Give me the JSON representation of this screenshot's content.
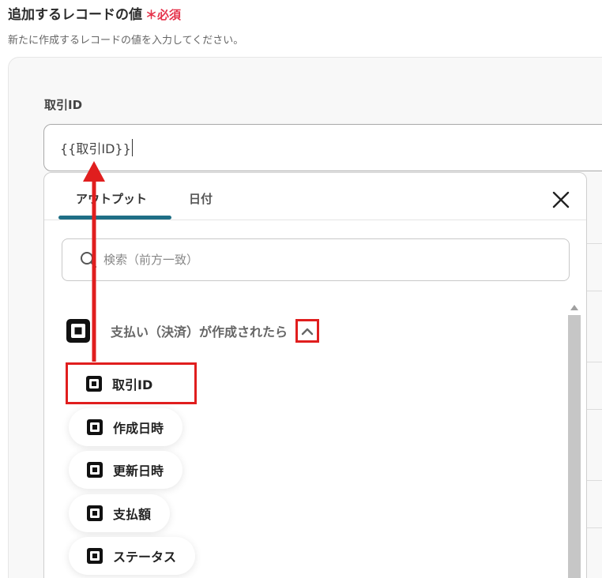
{
  "section": {
    "title": "追加するレコードの値",
    "required_mark": "＊必須",
    "description": "新たに作成するレコードの値を入力してください。"
  },
  "field": {
    "label": "取引ID",
    "value": "{{取引ID}}"
  },
  "dropdown": {
    "tabs": [
      {
        "label": "アウトプット",
        "active": true
      },
      {
        "label": "日付",
        "active": false
      }
    ],
    "search_placeholder": "検索（前方一致）",
    "group": {
      "title": "支払い（決済）が作成されたら",
      "expanded": true
    },
    "items": [
      {
        "label": "取引ID",
        "highlighted": true
      },
      {
        "label": "作成日時"
      },
      {
        "label": "更新日時"
      },
      {
        "label": "支払額"
      },
      {
        "label": "ステータス"
      }
    ]
  },
  "colors": {
    "accent_tab": "#1f6f86",
    "highlight": "#e01e1e",
    "required": "#e5334b"
  }
}
